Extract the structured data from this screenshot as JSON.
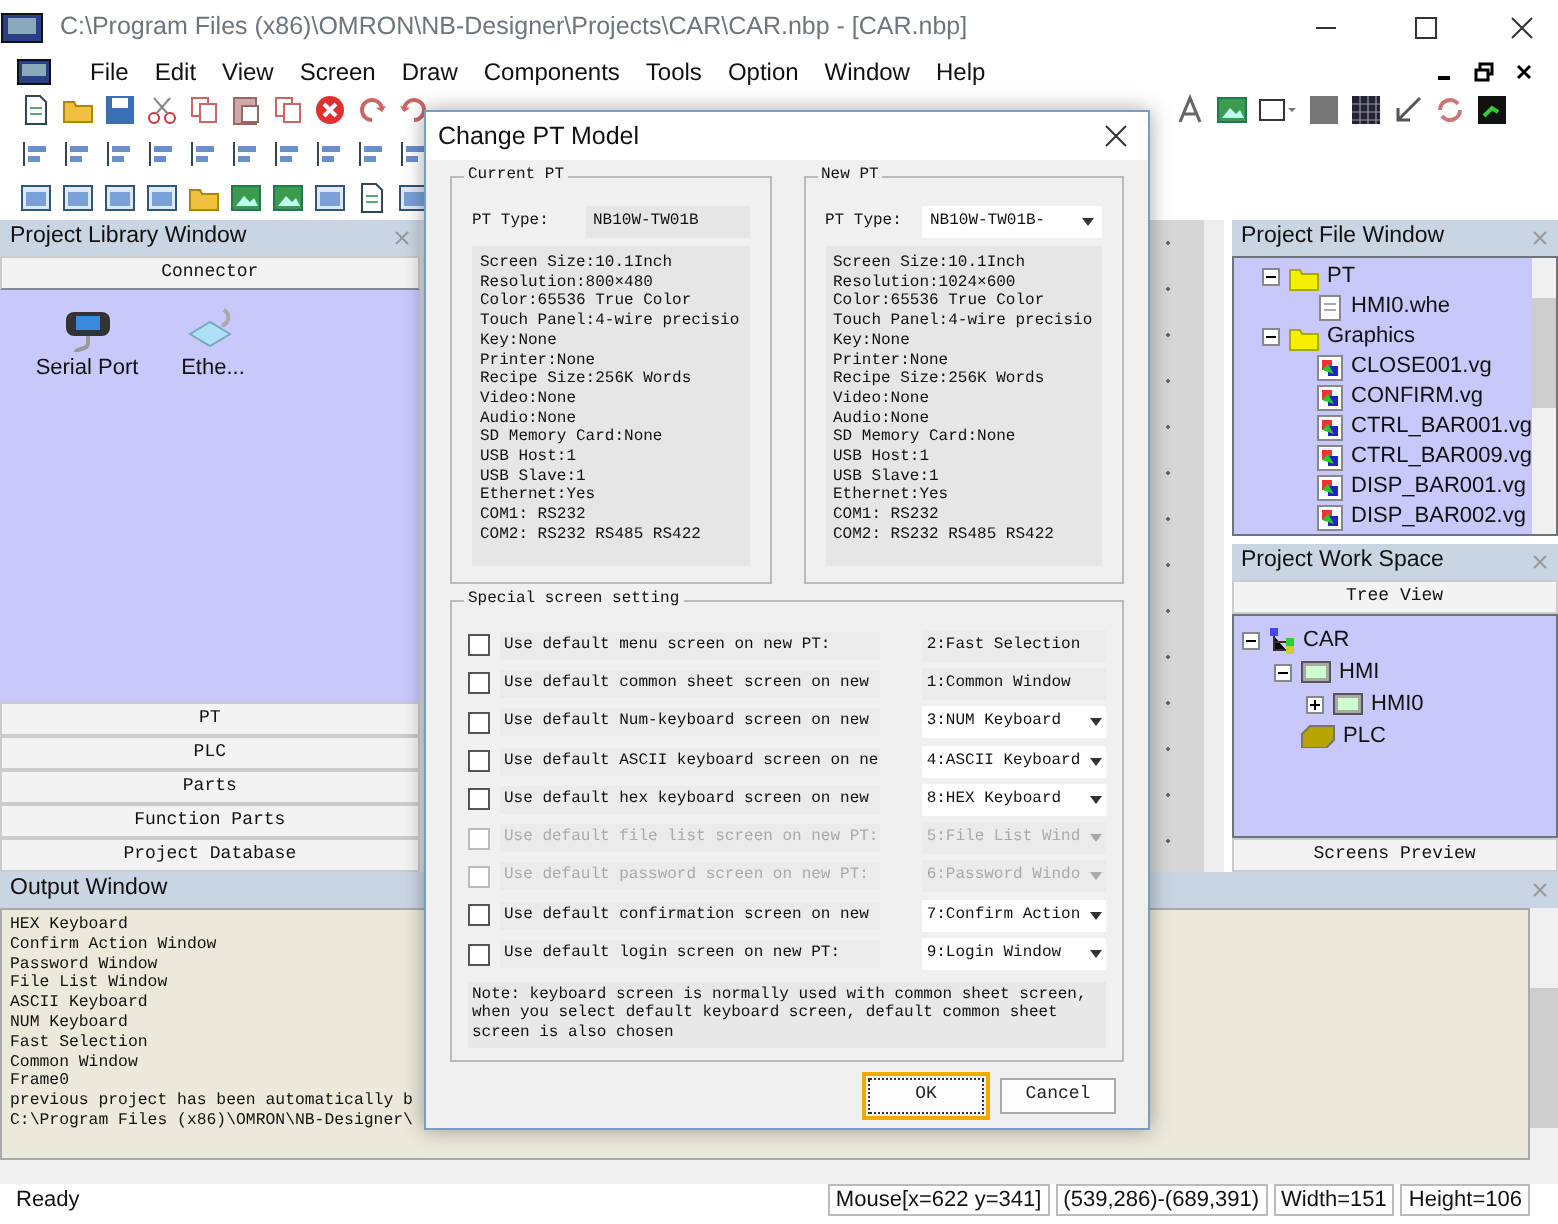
{
  "window": {
    "title": "C:\\Program Files (x86)\\OMRON\\NB-Designer\\Projects\\CAR\\CAR.nbp - [CAR.nbp]"
  },
  "menu": [
    "File",
    "Edit",
    "View",
    "Screen",
    "Draw",
    "Components",
    "Tools",
    "Option",
    "Window",
    "Help"
  ],
  "library": {
    "title": "Project Library Window",
    "categories": [
      {
        "label": "Connector",
        "selected": true,
        "items": [
          {
            "label": "Serial Port",
            "kind": "serial"
          },
          {
            "label": "Ethe...",
            "kind": "ethernet"
          }
        ]
      },
      {
        "label": "PT",
        "selected": false
      },
      {
        "label": "PLC",
        "selected": false
      },
      {
        "label": "Parts",
        "selected": false
      },
      {
        "label": "Function Parts",
        "selected": false
      },
      {
        "label": "Project Database",
        "selected": false
      }
    ]
  },
  "file_window": {
    "title": "Project File Window",
    "tree": [
      {
        "label": "PT",
        "kind": "folder",
        "expanded": true,
        "children": [
          {
            "label": "HMI0.whe",
            "kind": "file"
          }
        ]
      },
      {
        "label": "Graphics",
        "kind": "folder",
        "expanded": true,
        "children": [
          {
            "label": "CLOSE001.vg",
            "kind": "graphic"
          },
          {
            "label": "CONFIRM.vg",
            "kind": "graphic"
          },
          {
            "label": "CTRL_BAR001.vg",
            "kind": "graphic"
          },
          {
            "label": "CTRL_BAR009.vg",
            "kind": "graphic"
          },
          {
            "label": "DISP_BAR001.vg",
            "kind": "graphic"
          },
          {
            "label": "DISP_BAR002.vg",
            "kind": "graphic"
          }
        ]
      }
    ]
  },
  "workspace": {
    "title": "Project Work Space",
    "tab": "Tree View",
    "tree": [
      {
        "label": "CAR",
        "kind": "project",
        "expanded": true,
        "children": [
          {
            "label": "HMI",
            "kind": "hmi",
            "expanded": true,
            "children": [
              {
                "label": "HMI0",
                "kind": "hmi",
                "expanded": false
              }
            ]
          },
          {
            "label": "PLC",
            "kind": "plc"
          }
        ]
      }
    ],
    "footer": "Screens Preview"
  },
  "output": {
    "title": "Output Window",
    "lines": [
      "HEX Keyboard",
      "Confirm Action Window",
      "Password Window",
      "File List Window",
      "ASCII Keyboard",
      "NUM Keyboard",
      "Fast Selection",
      "Common Window",
      "Frame0",
      "previous project has been automatically b",
      "C:\\Program Files (x86)\\OMRON\\NB-Designer\\"
    ]
  },
  "status_bar": [
    "Ready",
    "Mouse[x=622  y=341]",
    "(539,286)-(689,391)",
    "Width=151",
    "Height=106"
  ],
  "dialog": {
    "title": "Change PT Model",
    "current_pt": {
      "title": "Current PT",
      "type_label": "PT Type:",
      "type_value": "NB10W-TW01B",
      "specs": [
        "Screen Size:10.1Inch",
        "Resolution:800×480",
        "Color:65536 True Color",
        "Touch Panel:4-wire precisio",
        "Key:None",
        "Printer:None",
        "Recipe Size:256K Words",
        "Video:None",
        "Audio:None",
        "SD Memory Card:None",
        "USB Host:1",
        "USB Slave:1",
        "Ethernet:Yes",
        "COM1: RS232",
        "COM2: RS232 RS485 RS422"
      ]
    },
    "new_pt": {
      "title": "New PT",
      "type_label": "PT Type:",
      "type_value": "NB10W-TW01B-",
      "specs": [
        "Screen Size:10.1Inch",
        "Resolution:1024×600",
        "Color:65536 True Color",
        "Touch Panel:4-wire precisio",
        "Key:None",
        "Printer:None",
        "Recipe Size:256K Words",
        "Video:None",
        "Audio:None",
        "SD Memory Card:None",
        "USB Host:1",
        "USB Slave:1",
        "Ethernet:Yes",
        "COM1: RS232",
        "COM2: RS232 RS485 RS422"
      ]
    },
    "special": {
      "title": "Special screen setting",
      "rows": [
        {
          "label": "Use default menu screen on new PT:",
          "checked": false,
          "disabled": false,
          "kind": "static",
          "value": "2:Fast Selection"
        },
        {
          "label": "Use default common sheet screen on new",
          "checked": false,
          "disabled": false,
          "kind": "static",
          "value": "1:Common Window"
        },
        {
          "label": "Use default Num-keyboard screen on new",
          "checked": false,
          "disabled": false,
          "kind": "dropdown",
          "value": "3:NUM Keyboard"
        },
        {
          "label": "Use default ASCII keyboard screen on ne",
          "checked": false,
          "disabled": false,
          "kind": "dropdown",
          "value": "4:ASCII Keyboard"
        },
        {
          "label": "Use default hex keyboard screen on new",
          "checked": false,
          "disabled": false,
          "kind": "dropdown",
          "value": "8:HEX Keyboard"
        },
        {
          "label": "Use default file list screen on new PT:",
          "checked": false,
          "disabled": true,
          "kind": "dropdown",
          "value": "5:File List Wind"
        },
        {
          "label": "Use default password screen on new PT:",
          "checked": false,
          "disabled": true,
          "kind": "dropdown",
          "value": "6:Password Windo"
        },
        {
          "label": "Use default confirmation screen on new",
          "checked": false,
          "disabled": false,
          "kind": "dropdown",
          "value": "7:Confirm Action"
        },
        {
          "label": "Use default login screen on new PT:",
          "checked": false,
          "disabled": false,
          "kind": "dropdown",
          "value": "9:Login Window"
        }
      ],
      "note": "Note: keyboard screen is normally used with common sheet screen, when you select default keyboard screen, default common sheet screen is also chosen"
    },
    "buttons": [
      {
        "label": "OK",
        "focused": true
      },
      {
        "label": "Cancel",
        "focused": false
      }
    ]
  }
}
